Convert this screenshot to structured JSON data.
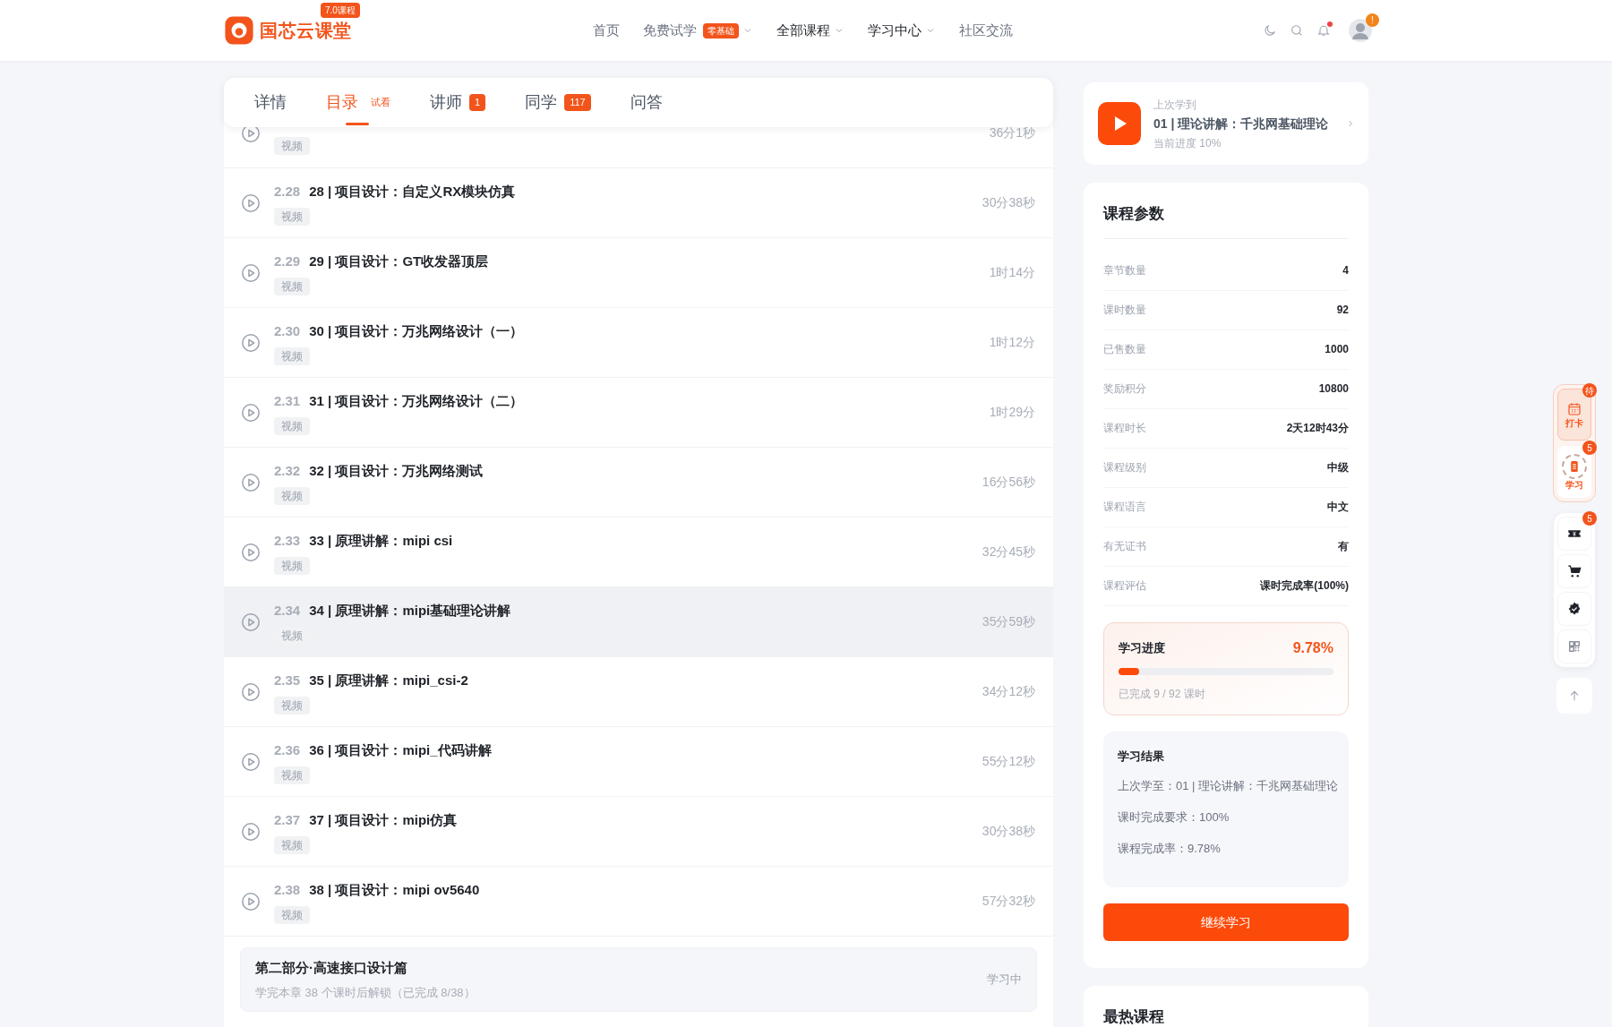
{
  "header": {
    "logo_text": "国芯云课堂",
    "logo_badge": "7.0课程",
    "nav": [
      {
        "label": "首页",
        "emphasized": false,
        "dropdown": false
      },
      {
        "label": "免费试学",
        "badge": "零基础",
        "emphasized": false,
        "dropdown": true
      },
      {
        "label": "全部课程",
        "emphasized": true,
        "dropdown": true
      },
      {
        "label": "学习中心",
        "emphasized": true,
        "dropdown": true
      },
      {
        "label": "社区交流",
        "emphasized": false,
        "dropdown": false
      }
    ],
    "has_unread": true,
    "avatar_badge": "!"
  },
  "tabs": [
    {
      "label": "详情",
      "selected": false
    },
    {
      "label": "目录",
      "note": "试看",
      "selected": true
    },
    {
      "label": "讲师",
      "badge": "1",
      "selected": false
    },
    {
      "label": "同学",
      "badge": "117",
      "selected": false
    },
    {
      "label": "问答",
      "selected": false
    }
  ],
  "lessons": [
    {
      "tag": "视频",
      "duration": "36分1秒"
    },
    {
      "number": "2.28",
      "title": "28 | 项目设计：自定义RX模块仿真",
      "tag": "视频",
      "duration": "30分38秒",
      "selected": false
    },
    {
      "number": "2.29",
      "title": "29 | 项目设计：GT收发器顶层",
      "tag": "视频",
      "duration": "1时14分",
      "selected": false
    },
    {
      "number": "2.30",
      "title": "30 | 项目设计：万兆网络设计（一）",
      "tag": "视频",
      "duration": "1时12分",
      "selected": false
    },
    {
      "number": "2.31",
      "title": "31 | 项目设计：万兆网络设计（二）",
      "tag": "视频",
      "duration": "1时29分",
      "selected": false
    },
    {
      "number": "2.32",
      "title": "32 | 项目设计：万兆网络测试",
      "tag": "视频",
      "duration": "16分56秒",
      "selected": false
    },
    {
      "number": "2.33",
      "title": "33 | 原理讲解：mipi csi",
      "tag": "视频",
      "duration": "32分45秒",
      "selected": false
    },
    {
      "number": "2.34",
      "title": "34 | 原理讲解：mipi基础理论讲解",
      "tag": "视频",
      "duration": "35分59秒",
      "selected": true
    },
    {
      "number": "2.35",
      "title": "35 | 原理讲解：mipi_csi-2",
      "tag": "视频",
      "duration": "34分12秒",
      "selected": false
    },
    {
      "number": "2.36",
      "title": "36 | 项目设计：mipi_代码讲解",
      "tag": "视频",
      "duration": "55分12秒",
      "selected": false
    },
    {
      "number": "2.37",
      "title": "37 | 项目设计：mipi仿真",
      "tag": "视频",
      "duration": "30分38秒",
      "selected": false
    },
    {
      "number": "2.38",
      "title": "38 | 项目设计：mipi ov5640",
      "tag": "视频",
      "duration": "57分32秒",
      "selected": false
    }
  ],
  "section": {
    "title": "第二部分·高速接口设计篇",
    "subtitle": "学完本章 38 个课时后解锁（已完成 8/38）",
    "status": "学习中"
  },
  "last_learned": {
    "label": "上次学到",
    "title": "01 | 理论讲解：千兆网基础理论",
    "progress": "当前进度 10%"
  },
  "params": {
    "title": "课程参数",
    "rows": [
      {
        "label": "章节数量",
        "value": "4"
      },
      {
        "label": "课时数量",
        "value": "92"
      },
      {
        "label": "已售数量",
        "value": "1000"
      },
      {
        "label": "奖励积分",
        "value": "10800"
      },
      {
        "label": "课程时长",
        "value": "2天12时43分"
      },
      {
        "label": "课程级别",
        "value": "中级"
      },
      {
        "label": "课程语言",
        "value": "中文"
      },
      {
        "label": "有无证书",
        "value": "有"
      },
      {
        "label": "课程评估",
        "value": "课时完成率(100%)"
      }
    ]
  },
  "study_progress": {
    "title": "学习进度",
    "percent": "9.78%",
    "level": 0.0978,
    "caption": "已完成 9 / 92 课时"
  },
  "result": {
    "title": "学习结果",
    "lines": [
      "上次学至：01 | 理论讲解：千兆网基础理论",
      "课时完成要求：100%",
      "课程完成率：9.78%"
    ]
  },
  "continue_button": "继续学习",
  "hot": {
    "title": "最热课程"
  },
  "side_tools": {
    "primary": [
      {
        "kind": "calendar",
        "label": "打卡",
        "badge": "待",
        "selected": true
      },
      {
        "kind": "book",
        "label": "学习",
        "badge": "5",
        "selected": false
      }
    ],
    "secondary": [
      {
        "kind": "ticket",
        "badge": "5"
      },
      {
        "kind": "cart"
      },
      {
        "kind": "verified"
      },
      {
        "kind": "qrcode"
      }
    ],
    "back_to_top": true
  }
}
